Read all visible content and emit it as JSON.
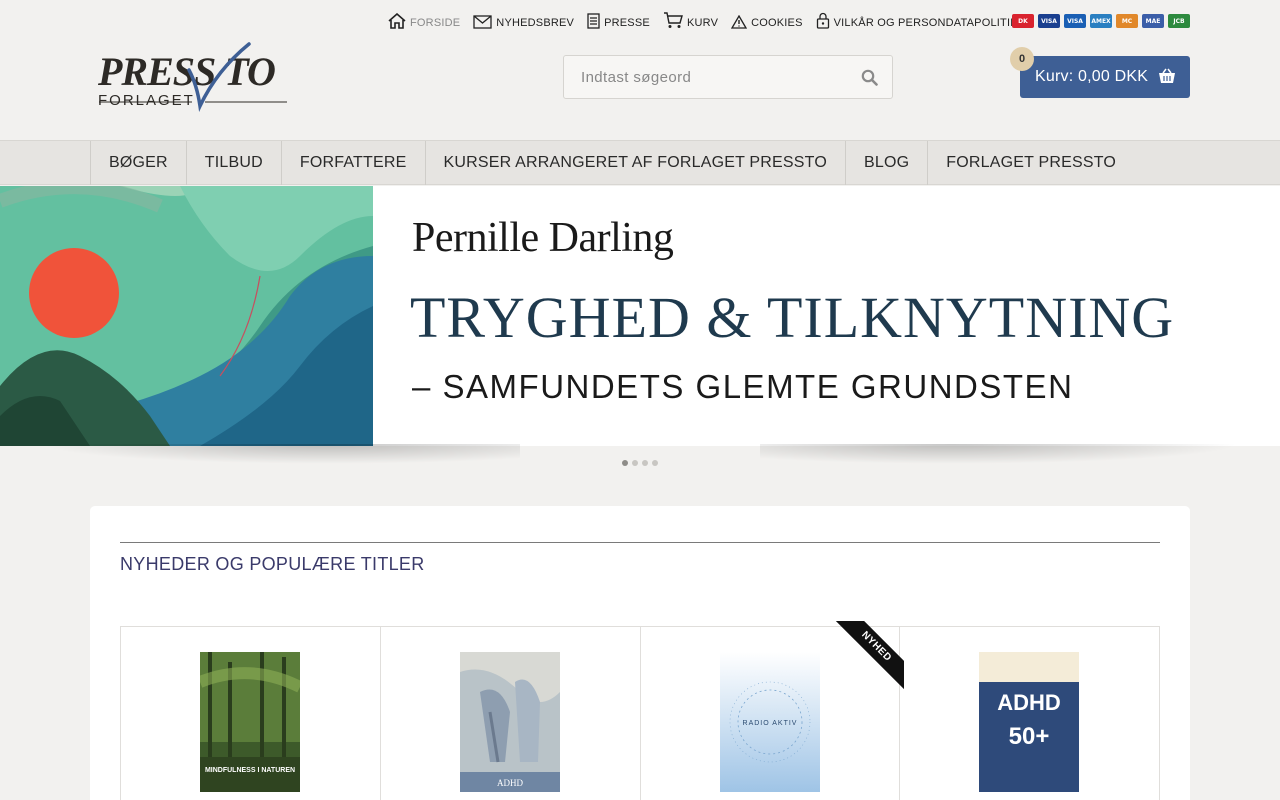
{
  "toplinks": [
    {
      "label": "FORSIDE",
      "icon": "home-icon"
    },
    {
      "label": "NYHEDSBREV",
      "icon": "envelope-icon"
    },
    {
      "label": "PRESSE",
      "icon": "document-icon"
    },
    {
      "label": "KURV",
      "icon": "cart-icon"
    },
    {
      "label": "COOKIES",
      "icon": "warning-icon"
    },
    {
      "label": "VILKÅR OG PERSONDATAPOLITIK",
      "icon": "lock-icon"
    }
  ],
  "payment_cards": [
    {
      "name": "dankort",
      "label": "DK",
      "color": "#d9232e"
    },
    {
      "name": "visa-dankort",
      "label": "VISA",
      "color": "#1a3f8f"
    },
    {
      "name": "visa",
      "label": "VISA",
      "color": "#1a5fb4"
    },
    {
      "name": "amex",
      "label": "AMEX",
      "color": "#2a7fc1"
    },
    {
      "name": "mastercard",
      "label": "MC",
      "color": "#e1882a"
    },
    {
      "name": "maestro",
      "label": "MAE",
      "color": "#3b5ea8"
    },
    {
      "name": "jcb",
      "label": "JCB",
      "color": "#2d8a3e"
    }
  ],
  "logo": {
    "word": "PRESS TO",
    "sub": "FORLAGET"
  },
  "search": {
    "placeholder": "Indtast søgeord"
  },
  "cart": {
    "label": "Kurv: 0,00 DKK",
    "count": "0"
  },
  "nav": [
    "BØGER",
    "TILBUD",
    "FORFATTERE",
    "KURSER ARRANGERET AF FORLAGET PRESSTO",
    "BLOG",
    "FORLAGET PRESSTO"
  ],
  "banner": {
    "author": "Pernille Darling",
    "title": "TRYGHED  & TILKNYTNING",
    "subtitle": "– SAMFUNDETS GLEMTE GRUNDSTEN"
  },
  "slider": {
    "count": 4,
    "active": 0
  },
  "section": {
    "title": "NYHEDER OG POPULÆRE TITLER"
  },
  "products": [
    {
      "cover_title": "MINDFULNESS I NATUREN",
      "cover_color": "#3d5a2a",
      "badge": ""
    },
    {
      "cover_title": "ADHD",
      "cover_color": "#8ea2b8",
      "badge": ""
    },
    {
      "cover_title": "RADIO AKTIV",
      "cover_color": "#cfe1f0",
      "badge": "NYHED"
    },
    {
      "cover_title": "ADHD 50+",
      "cover_color": "#2e4a7a",
      "badge": ""
    }
  ]
}
